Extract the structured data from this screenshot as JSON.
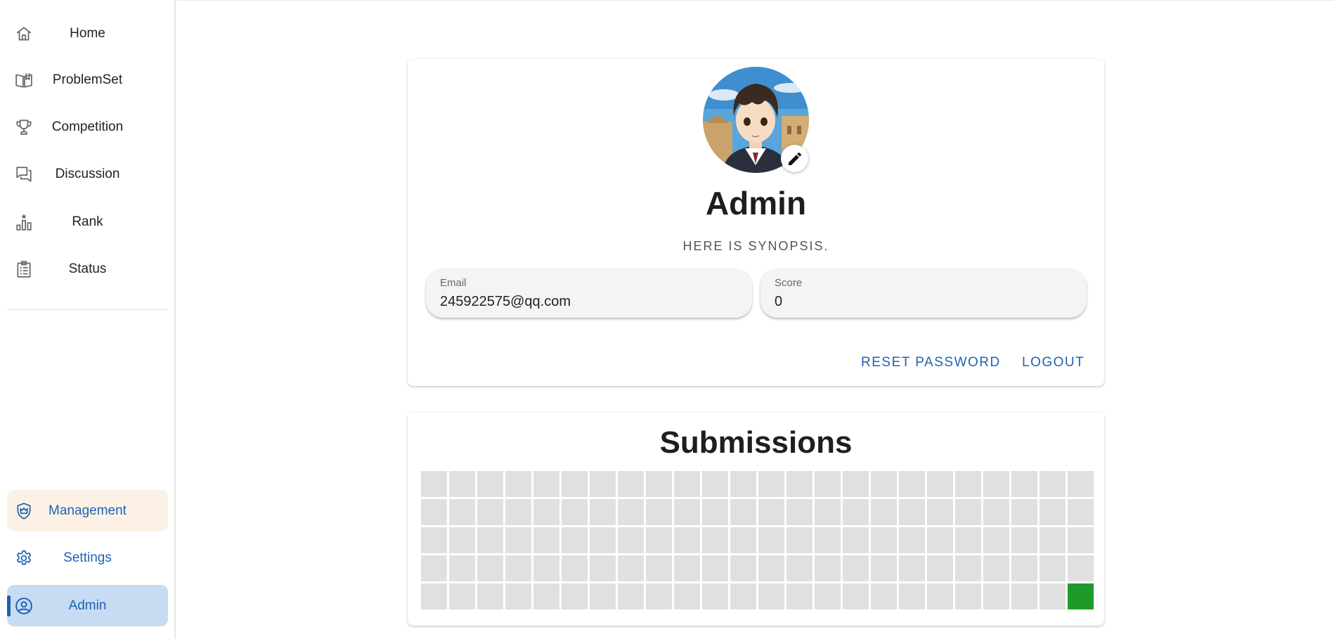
{
  "sidebar": {
    "items": [
      {
        "label": "Home",
        "icon": "home-icon"
      },
      {
        "label": "ProblemSet",
        "icon": "book-icon"
      },
      {
        "label": "Competition",
        "icon": "trophy-icon"
      },
      {
        "label": "Discussion",
        "icon": "forum-icon"
      },
      {
        "label": "Rank",
        "icon": "leaderboard-icon"
      },
      {
        "label": "Status",
        "icon": "clipboard-list-icon"
      }
    ],
    "bottom_items": [
      {
        "label": "Management",
        "icon": "shield-crown-icon"
      },
      {
        "label": "Settings",
        "icon": "gear-icon"
      },
      {
        "label": "Admin",
        "icon": "account-circle-icon"
      }
    ]
  },
  "profile": {
    "username": "Admin",
    "synopsis": "HERE IS SYNOPSIS.",
    "avatar_icon": "avatar-image",
    "edit_icon": "pencil-icon",
    "email_label": "Email",
    "email_value": "245922575@qq.com",
    "score_label": "Score",
    "score_value": "0",
    "reset_password": "RESET PASSWORD",
    "logout": "LOGOUT"
  },
  "submissions": {
    "title": "Submissions",
    "rows": 5,
    "columns": 24,
    "active_cells": [
      [
        4,
        23
      ]
    ]
  },
  "colors": {
    "accent": "#1e63b4",
    "active_nav_bg": "#c7dcf2",
    "management_bg": "#fdf1e6",
    "heat_empty": "#e0e0e0",
    "heat_active": "#1e9a2a"
  }
}
